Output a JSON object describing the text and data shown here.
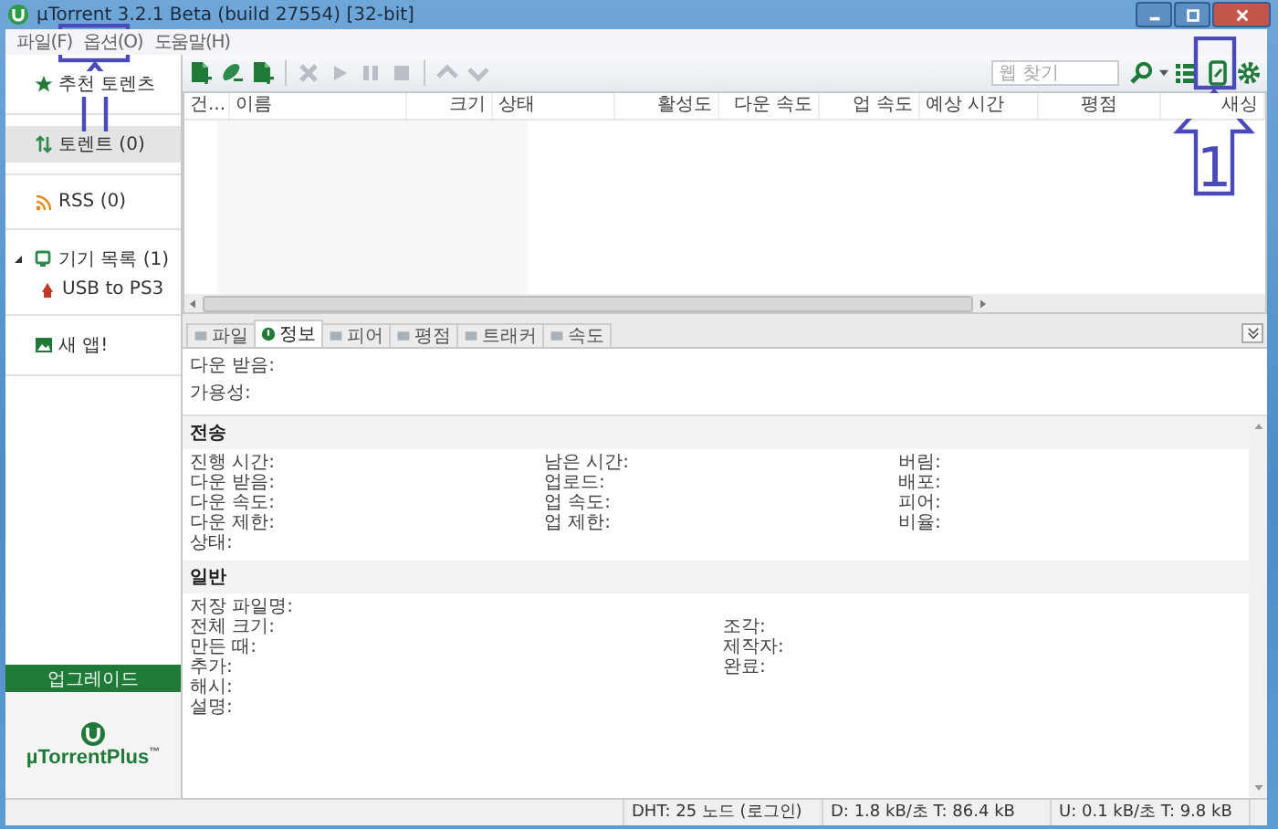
{
  "window": {
    "title": "µTorrent 3.2.1 Beta (build 27554) [32-bit]"
  },
  "menu": [
    "파일(F)",
    "옵션(O)",
    "도움말(H)"
  ],
  "sidebar": {
    "items": [
      {
        "label": "추천 토렌츠",
        "kind": "featured",
        "selected": false
      },
      {
        "label": "토렌트 (0)",
        "kind": "torrents",
        "selected": true
      },
      {
        "label": "RSS (0)",
        "kind": "rss",
        "selected": false
      },
      {
        "label": "기기 목록 (1)",
        "kind": "devices",
        "selected": false,
        "expanded": true,
        "children": [
          {
            "label": "USB to PS3",
            "kind": "device",
            "selected": false
          }
        ]
      },
      {
        "label": "새 앱!",
        "kind": "apps",
        "selected": false
      }
    ],
    "upgrade_button": "업그레이드",
    "logo": {
      "name": "µTorrentPlus",
      "mark": "™"
    }
  },
  "toolbar": {
    "search": {
      "placeholder": "웹 찾기"
    }
  },
  "table": {
    "columns": [
      "건...",
      "이름",
      "크기",
      "상태",
      "활성도",
      "다운 속도",
      "업 속도",
      "예상 시간",
      "평점",
      "새싱"
    ]
  },
  "detail_tabs": [
    {
      "label": "파일",
      "selected": false
    },
    {
      "label": "정보",
      "selected": true
    },
    {
      "label": "피어",
      "selected": false
    },
    {
      "label": "평점",
      "selected": false
    },
    {
      "label": "트래커",
      "selected": false
    },
    {
      "label": "속도",
      "selected": false
    }
  ],
  "info": {
    "top": [
      "다운 받음:",
      "가용성:"
    ],
    "transfer": {
      "title": "전송",
      "columns": [
        [
          "진행 시간:",
          "다운 받음:",
          "다운 속도:",
          "다운 제한:",
          "상태:"
        ],
        [
          "남은 시간:",
          "업로드:",
          "업 속도:",
          "업 제한:"
        ],
        [
          "버림:",
          "배포:",
          "피어:",
          "비율:"
        ]
      ]
    },
    "general": {
      "title": "일반",
      "columns": [
        [
          "저장 파일명:",
          "전체 크기:",
          "만든 때:",
          "추가:",
          "해시:",
          "설명:"
        ],
        [
          "",
          "조각:",
          "제작자:",
          "완료:"
        ]
      ]
    }
  },
  "status_bar": [
    "DHT: 25 노드 (로그인)",
    "D: 1.8 kB/초 T: 86.4 kB",
    "U: 0.1 kB/초 T: 9.8 kB"
  ],
  "annotations": [
    {
      "kind": "menu-arrow"
    },
    {
      "kind": "toolbar-arrow",
      "label": "1"
    }
  ]
}
